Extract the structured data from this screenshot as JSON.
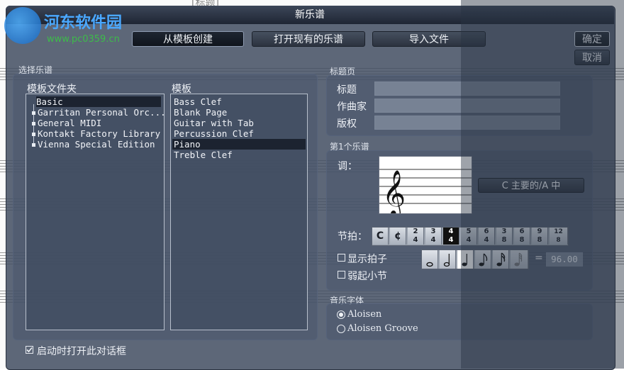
{
  "watermark": {
    "site_name": "河东软件园",
    "site_url": "www.pc0359.cn"
  },
  "background_score": {
    "title": "[标题]"
  },
  "dialog": {
    "title": "新乐谱",
    "ok_label": "确定",
    "cancel_label": "取消"
  },
  "mode_tabs": [
    {
      "label": "从模板创建",
      "selected": true
    },
    {
      "label": "打开现有的乐谱",
      "selected": false
    },
    {
      "label": "导入文件",
      "selected": false
    }
  ],
  "select_score": {
    "label": "选择乐谱",
    "folders_header": "模板文件夹",
    "folders": [
      "Basic",
      "Garritan Personal Orc...",
      "General MIDI",
      "Kontakt Factory Library",
      "Vienna Special Edition"
    ],
    "selected_folder": "Basic",
    "templates_header": "模板",
    "templates": [
      "Bass Clef",
      "Blank Page",
      "Guitar with Tab",
      "Percussion Clef",
      "Piano",
      "Treble Clef"
    ],
    "selected_template": "Piano"
  },
  "title_page": {
    "label": "标题页",
    "title_label": "标题",
    "title_value": "",
    "composer_label": "作曲家",
    "composer_value": "",
    "copyright_label": "版权",
    "copyright_value": ""
  },
  "first_staff": {
    "label": "第1个乐谱",
    "key_label": "调：",
    "key_value": "C 主要的/A 中",
    "time_label": "节拍：",
    "time_signatures": [
      "C",
      "¢",
      "2/4",
      "3/4",
      "4/4",
      "5/4",
      "6/4",
      "3/8",
      "6/8",
      "9/8",
      "12/8"
    ],
    "selected_time": "4/4",
    "show_beat_label": "显示拍子",
    "show_beat_checked": false,
    "pickup_label": "弱起小节",
    "pickup_checked": false,
    "tempo_equals": "=",
    "tempo_value": "96.00",
    "selected_note": "quarter"
  },
  "music_font": {
    "label": "音乐字体",
    "options": [
      "Aloisen",
      "Aloisen Groove"
    ],
    "selected": "Aloisen"
  },
  "startup_checkbox": {
    "label": "启动时打开此对话框",
    "checked": true
  }
}
